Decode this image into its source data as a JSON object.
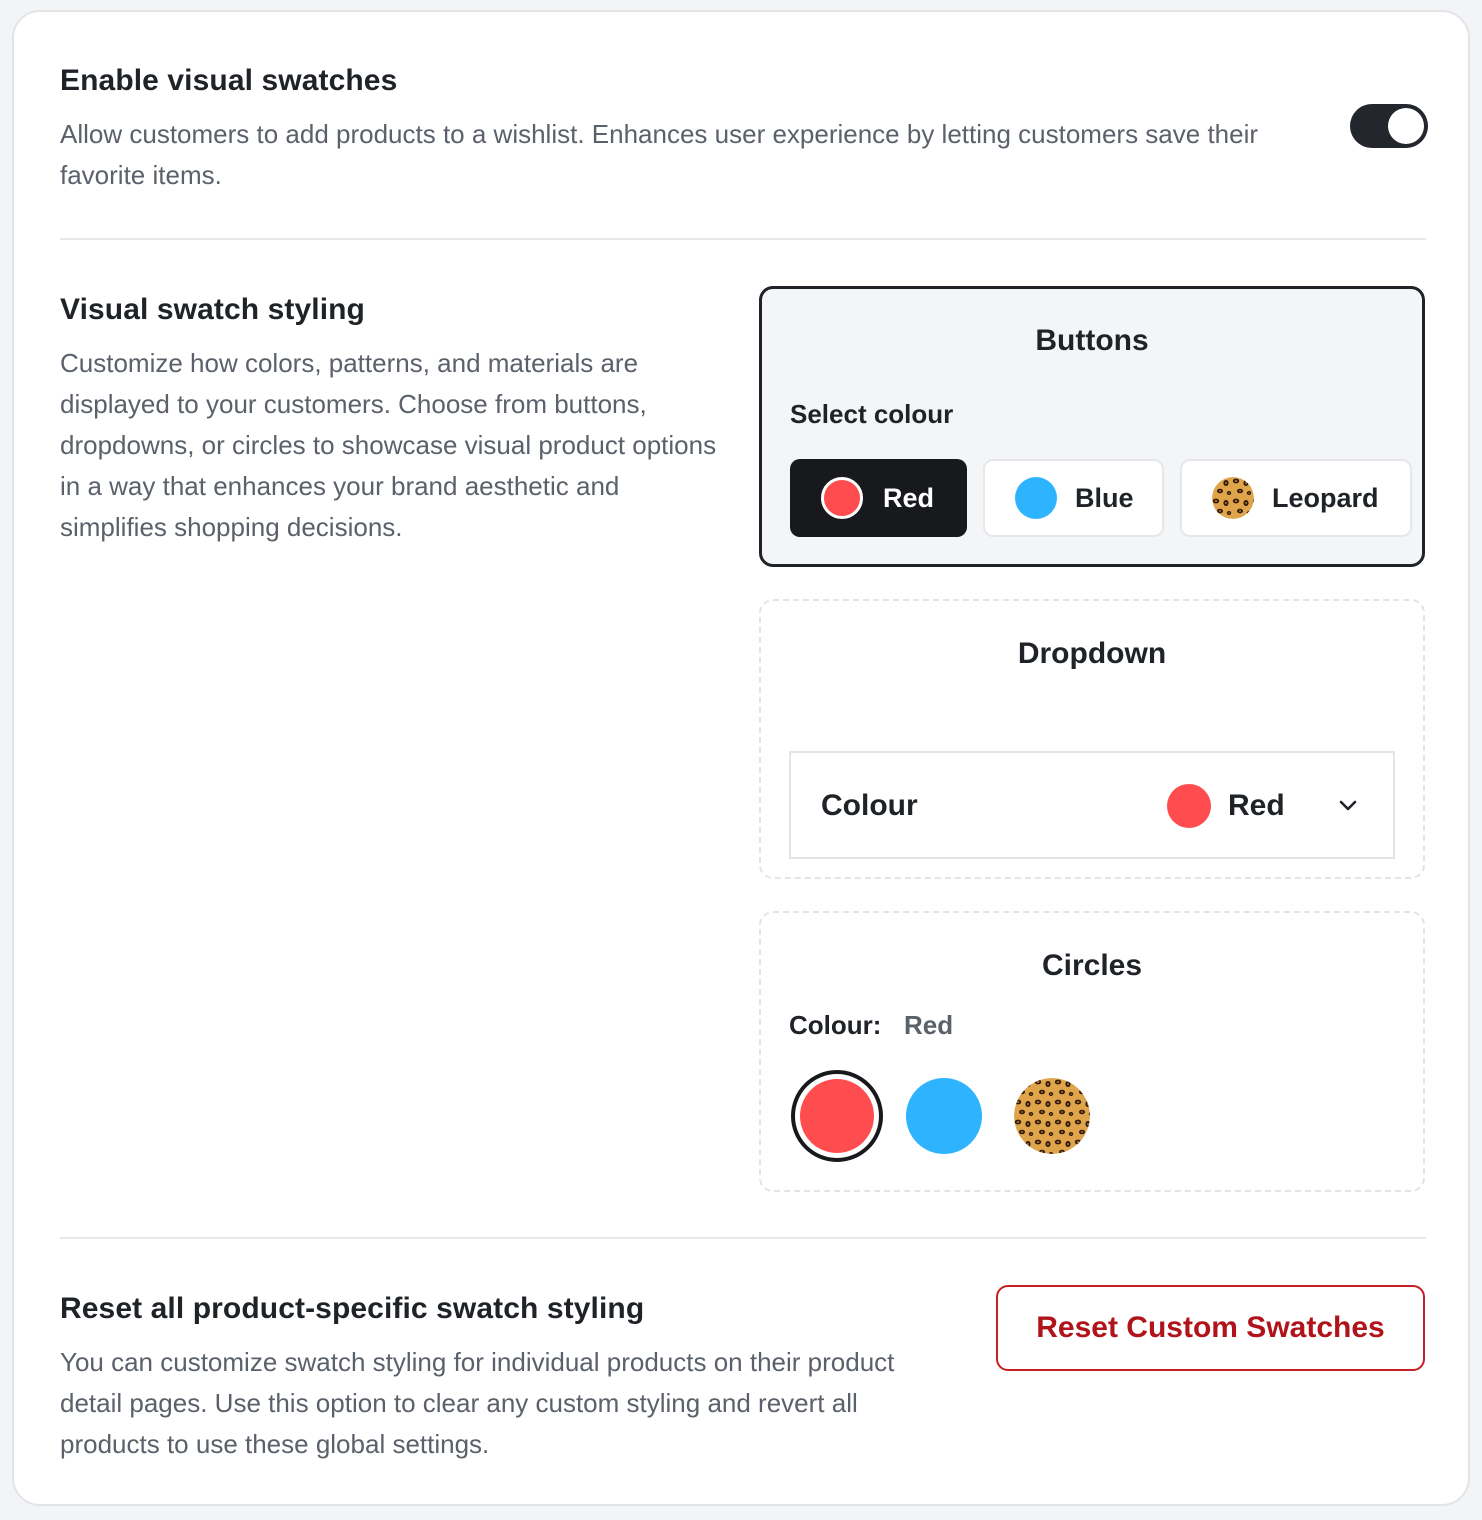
{
  "enable": {
    "title": "Enable visual swatches",
    "description": "Allow customers to add products to a wishlist. Enhances user experience by letting customers save their favorite items.",
    "toggle_on": true
  },
  "styling": {
    "title": "Visual swatch styling",
    "description": "Customize how colors, patterns, and materials are displayed to your customers. Choose from buttons, dropdowns, or circles to showcase visual product options in a way that enhances your brand aesthetic and simplifies shopping decisions.",
    "selected_option": "Buttons",
    "options": {
      "buttons": {
        "heading": "Buttons",
        "label": "Select colour",
        "swatches": [
          {
            "label": "Red",
            "color": "#ff4d4f",
            "selected": true
          },
          {
            "label": "Blue",
            "color": "#2eb4ff",
            "selected": false
          },
          {
            "label": "Leopard",
            "pattern": "leopard-print",
            "selected": false
          }
        ]
      },
      "dropdown": {
        "heading": "Dropdown",
        "label": "Colour",
        "value": "Red",
        "value_color": "#ff4d4f",
        "icon": "chevron-down-icon"
      },
      "circles": {
        "heading": "Circles",
        "label": "Colour:",
        "value": "Red",
        "swatches": [
          {
            "name": "red",
            "color": "#ff4d4f",
            "selected": true
          },
          {
            "name": "blue",
            "color": "#2eb4ff",
            "selected": false
          },
          {
            "name": "leopard",
            "pattern": "leopard-print",
            "selected": false
          }
        ]
      }
    }
  },
  "reset": {
    "title": "Reset all product-specific swatch styling",
    "description": "You can customize swatch styling for individual products on their product detail pages. Use this option to clear any custom styling and revert all products to use these global settings.",
    "button_label": "Reset Custom Swatches",
    "button_color": "#b0141a"
  }
}
